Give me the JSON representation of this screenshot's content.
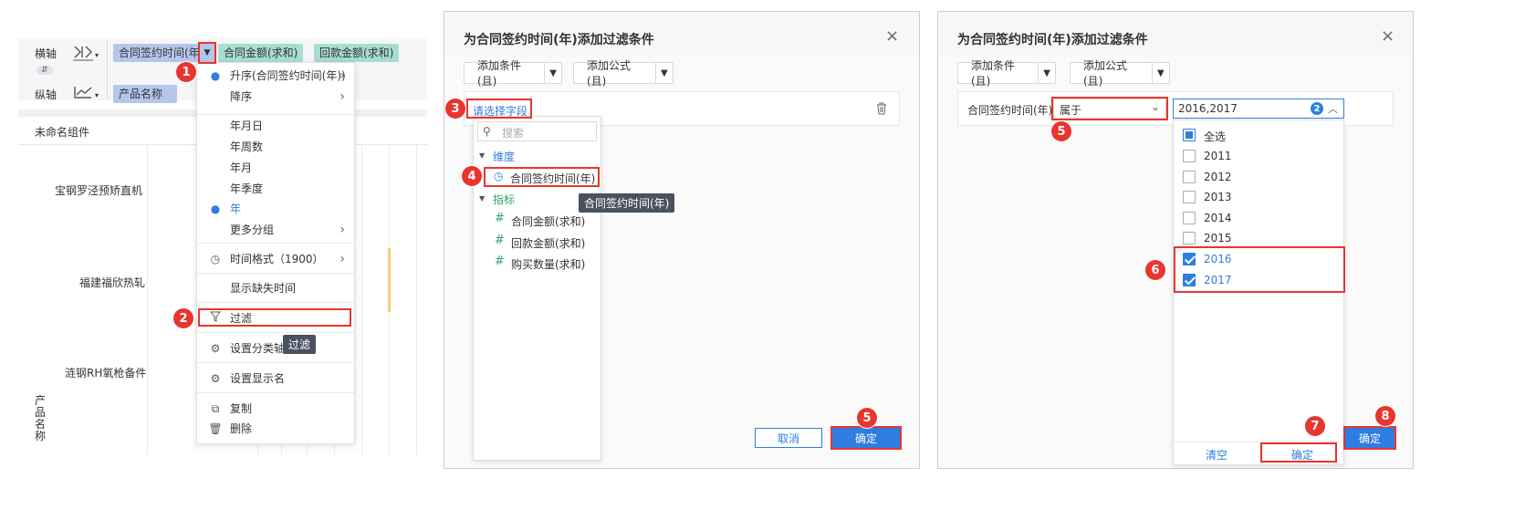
{
  "panel1": {
    "xaxis_label": "横轴",
    "yaxis_label": "纵轴",
    "xaxis_chips": [
      "合同签约时间(年)",
      "合同金额(求和)",
      "回款金额(求和)"
    ],
    "yaxis_chip": "产品名称",
    "component_title": "未命名组件",
    "rows": [
      "宝钢罗泾预矫直机",
      "福建福欣热轧",
      "涟钢RH氧枪备件"
    ],
    "yaxis_vertical_label": "产品名称",
    "menu": {
      "sort_asc": "升序(合同签约时间(年))",
      "sort_desc": "降序",
      "ymd": "年月日",
      "yweek": "年周数",
      "ym": "年月",
      "yq": "年季度",
      "year": "年",
      "more_group": "更多分组",
      "time_format": "时间格式（1900）",
      "show_missing": "显示缺失时间",
      "filter": "过滤",
      "set_category_axis": "设置分类轴",
      "set_display_name": "设置显示名",
      "copy": "复制",
      "delete": "删除"
    },
    "filter_tooltip": "过滤"
  },
  "dialog": {
    "title": "为合同签约时间(年)添加过滤条件",
    "add_condition": "添加条件(且)",
    "add_formula": "添加公式(且)",
    "cancel": "取消",
    "confirm": "确定"
  },
  "panel2": {
    "select_field": "请选择字段",
    "search_placeholder": "搜索",
    "dimension_group": "维度",
    "dimension_field": "合同签约时间(年)",
    "measure_group": "指标",
    "measures": [
      "合同金额(求和)",
      "回款金额(求和)",
      "购买数量(求和)"
    ],
    "tooltip": "合同签约时间(年)"
  },
  "panel3": {
    "field_label": "合同签约时间(年)",
    "operator": "属于",
    "value": "2016,2017",
    "value_count": "2",
    "select_all": "全选",
    "years": [
      "2011",
      "2012",
      "2013",
      "2014",
      "2015",
      "2016",
      "2017"
    ],
    "checked": [
      false,
      false,
      false,
      false,
      false,
      true,
      true
    ],
    "clear": "清空",
    "list_confirm": "确定"
  },
  "badges": [
    "1",
    "2",
    "3",
    "4",
    "5",
    "5",
    "6",
    "7",
    "8"
  ],
  "colors": {
    "accent_blue": "#2f7de1",
    "annotation_red": "#e8352e",
    "chip_dimension": "#b4c6ec",
    "chip_measure": "#a8ddd1",
    "tooltip_bg": "#4a5260"
  }
}
